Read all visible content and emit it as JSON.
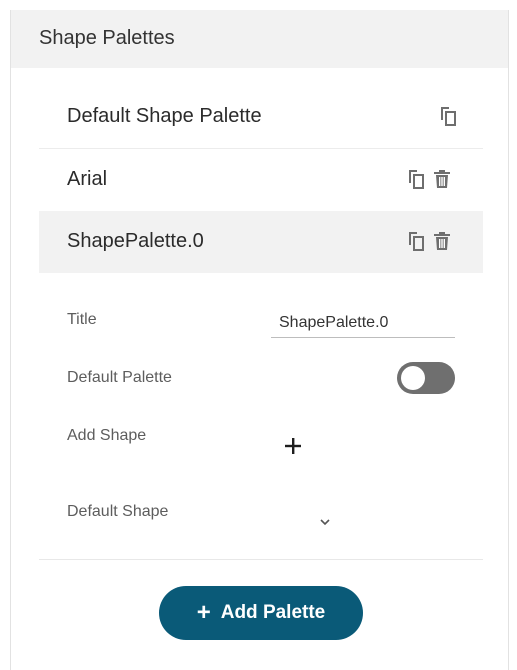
{
  "panel": {
    "title": "Shape Palettes"
  },
  "palettes": [
    {
      "label": "Default Shape Palette"
    },
    {
      "label": "Arial"
    },
    {
      "label": "ShapePalette.0"
    }
  ],
  "editor": {
    "title_label": "Title",
    "title_value": "ShapePalette.0",
    "default_palette_label": "Default Palette",
    "default_palette_on": false,
    "add_shape_label": "Add Shape",
    "default_shape_label": "Default Shape"
  },
  "add_palette": {
    "plus": "+",
    "label": "Add Palette"
  },
  "icons": {
    "copy": "copy-icon",
    "delete": "trash-icon",
    "add": "plus-icon",
    "dropdown": "chevron-down-icon"
  },
  "colors": {
    "accent": "#0a5a78",
    "toggle_off": "#6f6f6f",
    "header_bg": "#f2f2f2",
    "icon": "#6e6e6e"
  }
}
